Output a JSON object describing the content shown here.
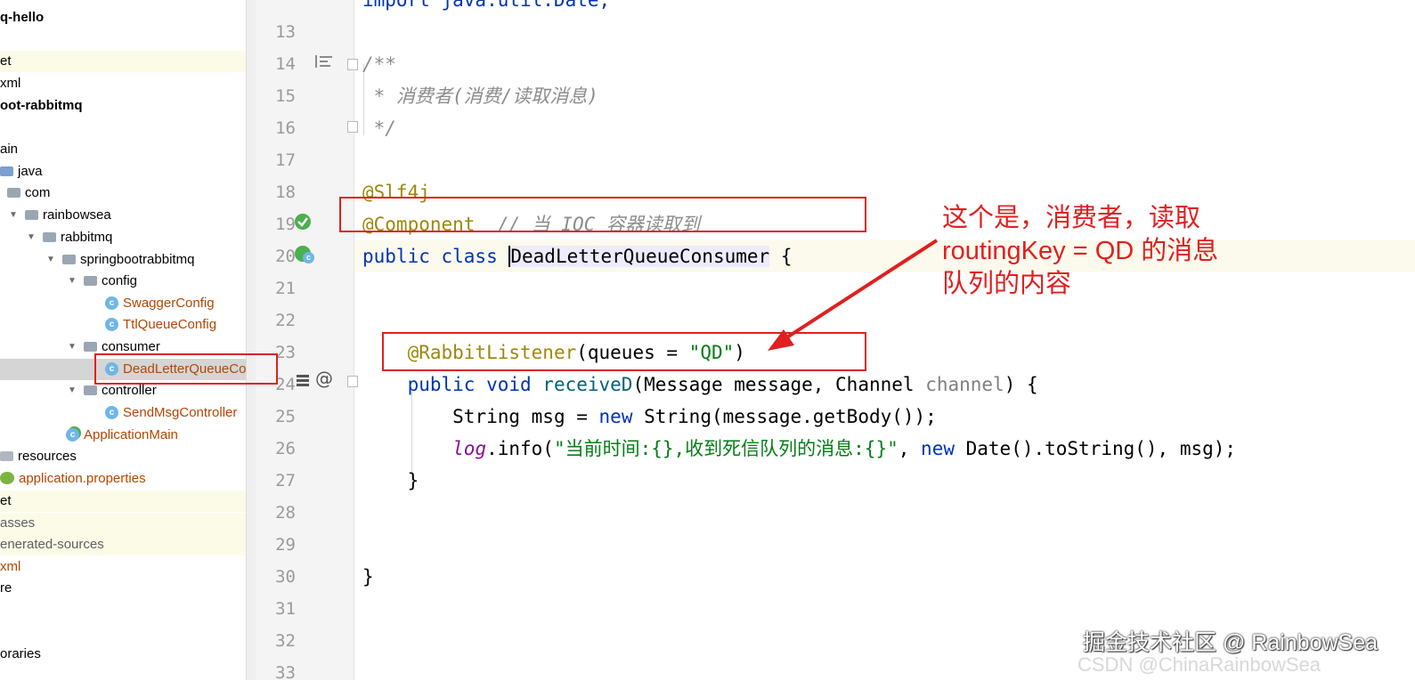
{
  "tree": {
    "items": [
      {
        "label": "q-hello",
        "style": "bold",
        "indent": 0,
        "icon": "none",
        "arrow": ""
      },
      {
        "label": "et",
        "style": "",
        "indent": 0,
        "icon": "none",
        "arrow": "",
        "highlight": "yellow"
      },
      {
        "label": "xml",
        "style": "",
        "indent": 0,
        "icon": "none",
        "arrow": ""
      },
      {
        "label": "oot-rabbitmq",
        "style": "bold",
        "indent": 0,
        "icon": "none",
        "arrow": ""
      },
      {
        "label": "",
        "style": "",
        "indent": 0,
        "icon": "none",
        "arrow": ""
      },
      {
        "label": "ain",
        "style": "",
        "indent": 0,
        "icon": "none",
        "arrow": ""
      },
      {
        "label": "java",
        "style": "",
        "indent": 0,
        "icon": "folder-blue",
        "arrow": ""
      },
      {
        "label": "com",
        "style": "",
        "indent": 1,
        "icon": "folder",
        "arrow": ""
      },
      {
        "label": "rainbowsea",
        "style": "",
        "indent": 1,
        "icon": "folder",
        "arrow": "▼"
      },
      {
        "label": "rabbitmq",
        "style": "",
        "indent": 2,
        "icon": "folder",
        "arrow": "▼"
      },
      {
        "label": "springbootrabbitmq",
        "style": "",
        "indent": 3,
        "icon": "folder",
        "arrow": "▼"
      },
      {
        "label": "config",
        "style": "",
        "indent": 4,
        "icon": "folder",
        "arrow": "▼"
      },
      {
        "label": "SwaggerConfig",
        "style": "orange",
        "indent": 5,
        "icon": "class",
        "arrow": ""
      },
      {
        "label": "TtlQueueConfig",
        "style": "orange",
        "indent": 5,
        "icon": "class",
        "arrow": ""
      },
      {
        "label": "consumer",
        "style": "",
        "indent": 4,
        "icon": "folder",
        "arrow": "▼"
      },
      {
        "label": "DeadLetterQueueCo",
        "style": "orange",
        "indent": 5,
        "icon": "class",
        "arrow": "",
        "highlight": "selected"
      },
      {
        "label": "controller",
        "style": "",
        "indent": 4,
        "icon": "folder",
        "arrow": "▼"
      },
      {
        "label": "SendMsgController",
        "style": "orange",
        "indent": 5,
        "icon": "class",
        "arrow": ""
      },
      {
        "label": "ApplicationMain",
        "style": "orange",
        "indent": 4,
        "icon": "app",
        "arrow": ""
      },
      {
        "label": "resources",
        "style": "",
        "indent": 0,
        "icon": "folder-res",
        "arrow": ""
      },
      {
        "label": "application.properties",
        "style": "orange",
        "indent": 0,
        "icon": "prop",
        "arrow": ""
      },
      {
        "label": "et",
        "style": "",
        "indent": 0,
        "icon": "none",
        "arrow": "",
        "highlight": "yellow"
      },
      {
        "label": "asses",
        "style": "gray",
        "indent": 0,
        "icon": "none",
        "arrow": "",
        "highlight": "yellow"
      },
      {
        "label": "enerated-sources",
        "style": "gray",
        "indent": 0,
        "icon": "none",
        "arrow": "",
        "highlight": "yellow"
      },
      {
        "label": "xml",
        "style": "orange",
        "indent": 0,
        "icon": "none",
        "arrow": ""
      },
      {
        "label": "re",
        "style": "",
        "indent": 0,
        "icon": "none",
        "arrow": ""
      },
      {
        "label": "",
        "style": "",
        "indent": 0,
        "icon": "none",
        "arrow": ""
      },
      {
        "label": "",
        "style": "",
        "indent": 0,
        "icon": "none",
        "arrow": ""
      },
      {
        "label": "oraries",
        "style": "",
        "indent": 0,
        "icon": "none",
        "arrow": ""
      }
    ]
  },
  "editor": {
    "line_numbers": [
      "13",
      "14",
      "15",
      "16",
      "17",
      "18",
      "19",
      "20",
      "21",
      "22",
      "23",
      "24",
      "25",
      "26",
      "27",
      "28",
      "29",
      "30",
      "31",
      "32",
      "33"
    ],
    "top_partial": "import java.util.Date;",
    "lines": {
      "l14": "/**",
      "l15": " * 消费者(消费/读取消息)",
      "l16": " */",
      "l18": "@Slf4j",
      "l19_ann": "@Component",
      "l19_cmt": "  // 当 IOC 容器读取到",
      "l20_kw": "public class ",
      "l20_name": "DeadLetterQueueConsumer",
      "l20_rest": " {",
      "l23_ann": "@RabbitListener",
      "l23_rest1": "(queues = ",
      "l23_str": "\"QD\"",
      "l23_rest2": ")",
      "l24_kw": "public void ",
      "l24_fn": "receiveD",
      "l24_rest1": "(Message message, Channel ",
      "l24_unused": "channel",
      "l24_rest2": ") {",
      "l25_a": "String msg = ",
      "l25_kw": "new ",
      "l25_b": "String(message.getBody());",
      "l26_log": "log",
      "l26_a": ".info(",
      "l26_str": "\"当前时间:{},收到死信队列的消息:{}\"",
      "l26_b": ", ",
      "l26_kw": "new ",
      "l26_c": "Date().toString(), msg);",
      "l27": "}",
      "l30": "}"
    }
  },
  "annotation": {
    "note_line1": "这个是，消费者，读取",
    "note_line2": "routingKey = QD 的消息",
    "note_line3": "队列的内容",
    "color": "#e02020"
  },
  "watermark": {
    "text": "掘金技术社区 @ RainbowSea",
    "sub": "CSDN @ChinaRainbowSea"
  },
  "colors": {
    "keyword": "#0033b3",
    "annotation": "#9e880d",
    "string": "#067d17",
    "comment": "#8c8c8c"
  }
}
